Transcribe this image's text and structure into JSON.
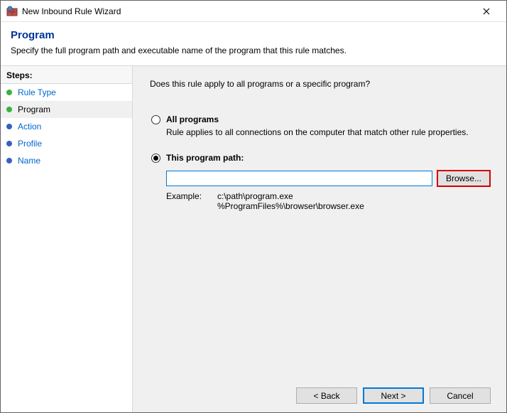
{
  "window": {
    "title": "New Inbound Rule Wizard"
  },
  "header": {
    "title": "Program",
    "subtitle": "Specify the full program path and executable name of the program that this rule matches."
  },
  "sidebar": {
    "steps_label": "Steps:",
    "items": [
      {
        "label": "Rule Type",
        "state": "done"
      },
      {
        "label": "Program",
        "state": "current"
      },
      {
        "label": "Action",
        "state": "pending"
      },
      {
        "label": "Profile",
        "state": "pending"
      },
      {
        "label": "Name",
        "state": "pending"
      }
    ]
  },
  "content": {
    "question": "Does this rule apply to all programs or a specific program?",
    "options": {
      "all": {
        "title": "All programs",
        "desc": "Rule applies to all connections on the computer that match other rule properties.",
        "selected": false
      },
      "path": {
        "title": "This program path:",
        "selected": true,
        "value": "",
        "browse_label": "Browse...",
        "example_label": "Example:",
        "example_text": "c:\\path\\program.exe\n%ProgramFiles%\\browser\\browser.exe"
      }
    }
  },
  "buttons": {
    "back": "< Back",
    "next": "Next >",
    "cancel": "Cancel"
  }
}
